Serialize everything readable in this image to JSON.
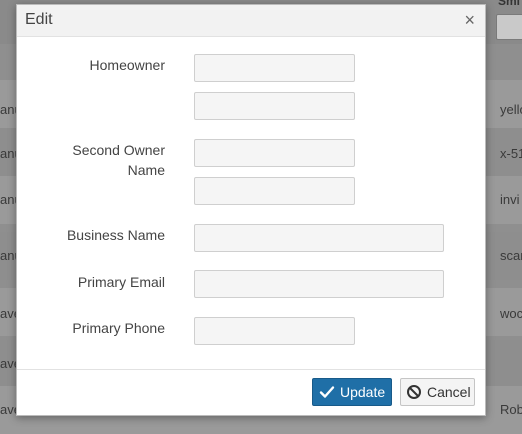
{
  "background": {
    "header_label": "Smi",
    "rows": [
      {
        "left": "anu",
        "right": "yello"
      },
      {
        "left": "anu",
        "right": "x-51"
      },
      {
        "left": "anu",
        "right": "invi"
      },
      {
        "left": "anu",
        "right": "scar"
      },
      {
        "left": "ave",
        "right": "woc"
      },
      {
        "left": "ave",
        "right": ""
      },
      {
        "left": "ave",
        "right": "Rob"
      }
    ]
  },
  "modal": {
    "title": "Edit",
    "close_symbol": "×",
    "fields": {
      "homeowner_label": "Homeowner",
      "homeowner_value_1": "",
      "homeowner_value_2": "",
      "second_owner_label_line1": "Second Owner",
      "second_owner_label_line2": "Name",
      "second_owner_value_1": "",
      "second_owner_value_2": "",
      "business_name_label": "Business Name",
      "business_name_value": "",
      "primary_email_label": "Primary Email",
      "primary_email_value": "",
      "primary_phone_label": "Primary Phone",
      "primary_phone_value": ""
    },
    "footer": {
      "update_label": "Update",
      "cancel_label": "Cancel"
    }
  },
  "colors": {
    "primary": "#1f6fa7",
    "overlay": "#8f8f8f"
  },
  "icons": {
    "close": "close-icon",
    "update": "check-icon",
    "cancel": "ban-icon"
  }
}
